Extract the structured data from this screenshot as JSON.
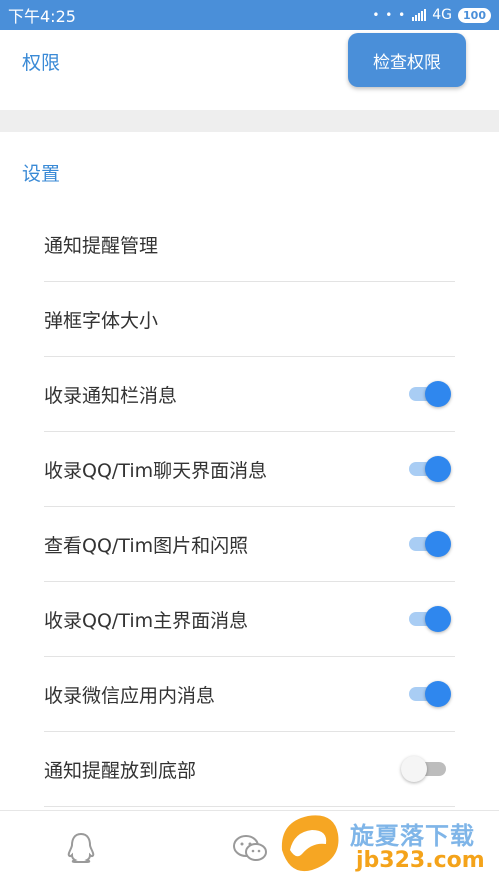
{
  "status_bar": {
    "time": "下午4:25",
    "dots": "• • •",
    "network": "4G",
    "battery": "100"
  },
  "permissions": {
    "title": "权限",
    "check_button": "检查权限"
  },
  "settings": {
    "title": "设置",
    "items": [
      {
        "label": "通知提醒管理"
      },
      {
        "label": "弹框字体大小"
      },
      {
        "label": "收录通知栏消息",
        "toggle": "on"
      },
      {
        "label": "收录QQ/Tim聊天界面消息",
        "toggle": "on"
      },
      {
        "label": "查看QQ/Tim图片和闪照",
        "toggle": "on"
      },
      {
        "label": "收录QQ/Tim主界面消息",
        "toggle": "on"
      },
      {
        "label": "收录微信应用内消息",
        "toggle": "on"
      },
      {
        "label": "通知提醒放到底部",
        "toggle": "off"
      }
    ]
  },
  "bottom_nav": {
    "items": [
      {
        "icon": "qq-penguin-icon"
      },
      {
        "icon": "wechat-icon"
      }
    ]
  },
  "watermark": {
    "text": "旋夏落下载",
    "url": "jb323.com"
  },
  "colors": {
    "primary": "#4a8fd9",
    "title_blue": "#3a8ad6",
    "toggle_on": "#2f87ee",
    "toggle_track_on": "#a9cdf4",
    "toggle_off": "#bdbdbd"
  }
}
